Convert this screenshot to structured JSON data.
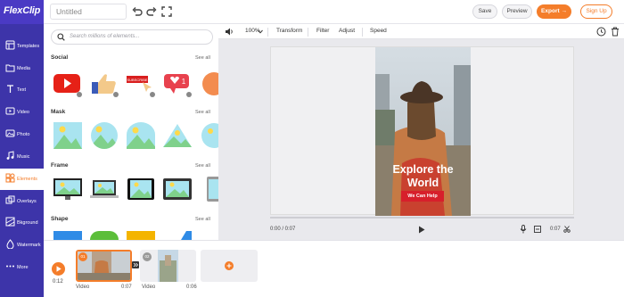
{
  "header": {
    "logo": "FlexClip",
    "title_value": "Untitled",
    "save_label": "Save",
    "preview_label": "Preview",
    "export_label": "Export →",
    "signup_label": "Sign Up"
  },
  "sidebar": {
    "items": [
      {
        "label": "Templates",
        "icon": "templates-icon"
      },
      {
        "label": "Media",
        "icon": "media-icon"
      },
      {
        "label": "Text",
        "icon": "text-icon"
      },
      {
        "label": "Video",
        "icon": "video-icon"
      },
      {
        "label": "Photo",
        "icon": "photo-icon"
      },
      {
        "label": "Music",
        "icon": "music-icon"
      },
      {
        "label": "Elements",
        "icon": "elements-icon",
        "active": true
      },
      {
        "label": "Overlays",
        "icon": "overlays-icon"
      },
      {
        "label": "Bkground",
        "icon": "background-icon"
      },
      {
        "label": "Watermark",
        "icon": "watermark-icon"
      },
      {
        "label": "More",
        "icon": "more-icon"
      }
    ]
  },
  "panel": {
    "search_placeholder": "Search millions of elements...",
    "sections": [
      {
        "title": "Social",
        "see_all": "See all"
      },
      {
        "title": "Mask",
        "see_all": "See all"
      },
      {
        "title": "Frame",
        "see_all": "See all"
      },
      {
        "title": "Shape",
        "see_all": "See all"
      }
    ],
    "social_items": [
      "youtube-play-icon",
      "thumbs-up-icon",
      "subscribe-button-icon",
      "like-count-icon",
      "orange-circle-icon"
    ],
    "like_count": "1",
    "subscribe_text": "SUBSCRIBE"
  },
  "toolbar": {
    "zoom": "100%",
    "transform_label": "Transform",
    "filter_label": "Filter",
    "adjust_label": "Adjust",
    "speed_label": "Speed"
  },
  "stage": {
    "headline_line1": "Explore the",
    "headline_line2": "World",
    "cta_label": "We Can Help",
    "current_time": "0:00 / 0:07",
    "end_time": "0:07"
  },
  "timeline": {
    "total_time": "0:12",
    "clips": [
      {
        "type": "Video",
        "duration": "0:07",
        "badge": "01"
      },
      {
        "type": "Video",
        "duration": "0:06",
        "badge": "02"
      }
    ]
  },
  "colors": {
    "brand_purple": "#3d34a9",
    "accent_orange": "#f47d2a",
    "cta_red": "#d71f2b"
  }
}
